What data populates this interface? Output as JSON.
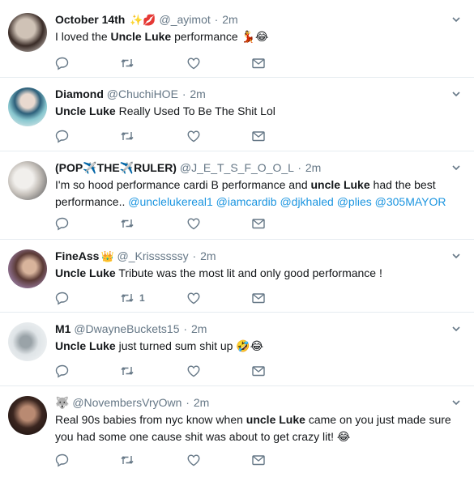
{
  "tweets": [
    {
      "name": "October 14th",
      "name_emoji": "✨💋",
      "handle": "@_ayimot",
      "dot": "·",
      "time": "2m",
      "text_parts": [
        {
          "t": "I loved the ",
          "s": "plain"
        },
        {
          "t": "Uncle Luke",
          "s": "bold"
        },
        {
          "t": " performance 💃😂",
          "s": "plain"
        }
      ],
      "retweet_count": ""
    },
    {
      "name": "Diamond",
      "name_emoji": "",
      "handle": "@ChuchiHOE",
      "dot": "·",
      "time": "2m",
      "text_parts": [
        {
          "t": "Uncle Luke",
          "s": "bold"
        },
        {
          "t": " Really Used To Be The Shit Lol",
          "s": "plain"
        }
      ],
      "retweet_count": ""
    },
    {
      "name": "(POP✈️THE✈️RULER)",
      "name_emoji": "",
      "handle": "@J_E_T_S_F_O_O_L",
      "dot": "·",
      "time": "2m",
      "text_parts": [
        {
          "t": "I'm so hood performance cardi B performance and ",
          "s": "plain"
        },
        {
          "t": "uncle Luke",
          "s": "bold"
        },
        {
          "t": " had the best performance..  ",
          "s": "plain"
        },
        {
          "t": "@unclelukereal1",
          "s": "link"
        },
        {
          "t": " ",
          "s": "plain"
        },
        {
          "t": "@iamcardib",
          "s": "link"
        },
        {
          "t": " ",
          "s": "plain"
        },
        {
          "t": "@djkhaled",
          "s": "link"
        },
        {
          "t": " ",
          "s": "plain"
        },
        {
          "t": "@plies",
          "s": "link"
        },
        {
          "t": " ",
          "s": "plain"
        },
        {
          "t": "@305MAYOR",
          "s": "link"
        }
      ],
      "retweet_count": ""
    },
    {
      "name": "FineAss",
      "name_emoji": "👑",
      "handle": "@_Krissssssy",
      "dot": "·",
      "time": "2m",
      "text_parts": [
        {
          "t": "Uncle Luke",
          "s": "bold"
        },
        {
          "t": " Tribute was the most lit and only good performance !",
          "s": "plain"
        }
      ],
      "retweet_count": "1"
    },
    {
      "name": "M1",
      "name_emoji": "",
      "handle": "@DwayneBuckets15",
      "dot": "·",
      "time": "2m",
      "text_parts": [
        {
          "t": "Uncle Luke",
          "s": "bold"
        },
        {
          "t": " just turned sum shit up 🤣😂",
          "s": "plain"
        }
      ],
      "retweet_count": ""
    },
    {
      "name": "🐺",
      "name_emoji": "",
      "handle": "@NovembersVryOwn",
      "dot": "·",
      "time": "2m",
      "text_parts": [
        {
          "t": "Real 90s babies from nyc know when ",
          "s": "plain"
        },
        {
          "t": "uncle Luke",
          "s": "bold"
        },
        {
          "t": " came on you just made sure you had some one cause shit was about to get crazy lit! 😂",
          "s": "plain"
        }
      ],
      "retweet_count": ""
    }
  ],
  "icons": {
    "reply": "reply-icon",
    "retweet": "retweet-icon",
    "like": "heart-icon",
    "message": "envelope-icon",
    "menu": "chevron-down-icon"
  },
  "colors": {
    "text": "#14171a",
    "secondary": "#657786",
    "link": "#1b95e0",
    "divider": "#e6ecf0"
  }
}
